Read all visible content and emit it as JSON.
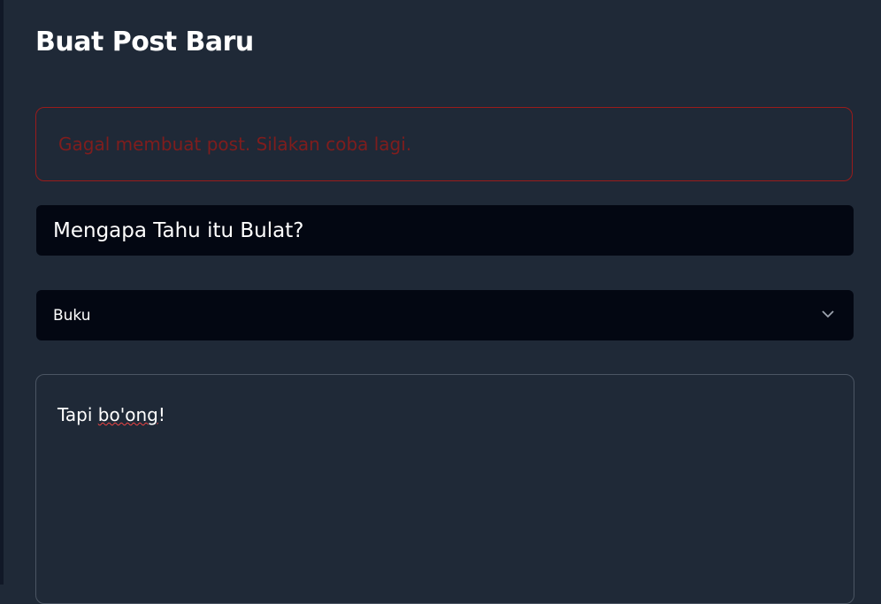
{
  "page": {
    "title": "Buat Post Baru"
  },
  "alert": {
    "message": "Gagal membuat post. Silakan coba lagi.",
    "color": "#991b1b"
  },
  "form": {
    "title_value": "Mengapa Tahu itu Bulat?",
    "category_value": "Buku",
    "content_prefix": "Tapi ",
    "content_misspelled": "bo'ong",
    "content_suffix": "!"
  }
}
